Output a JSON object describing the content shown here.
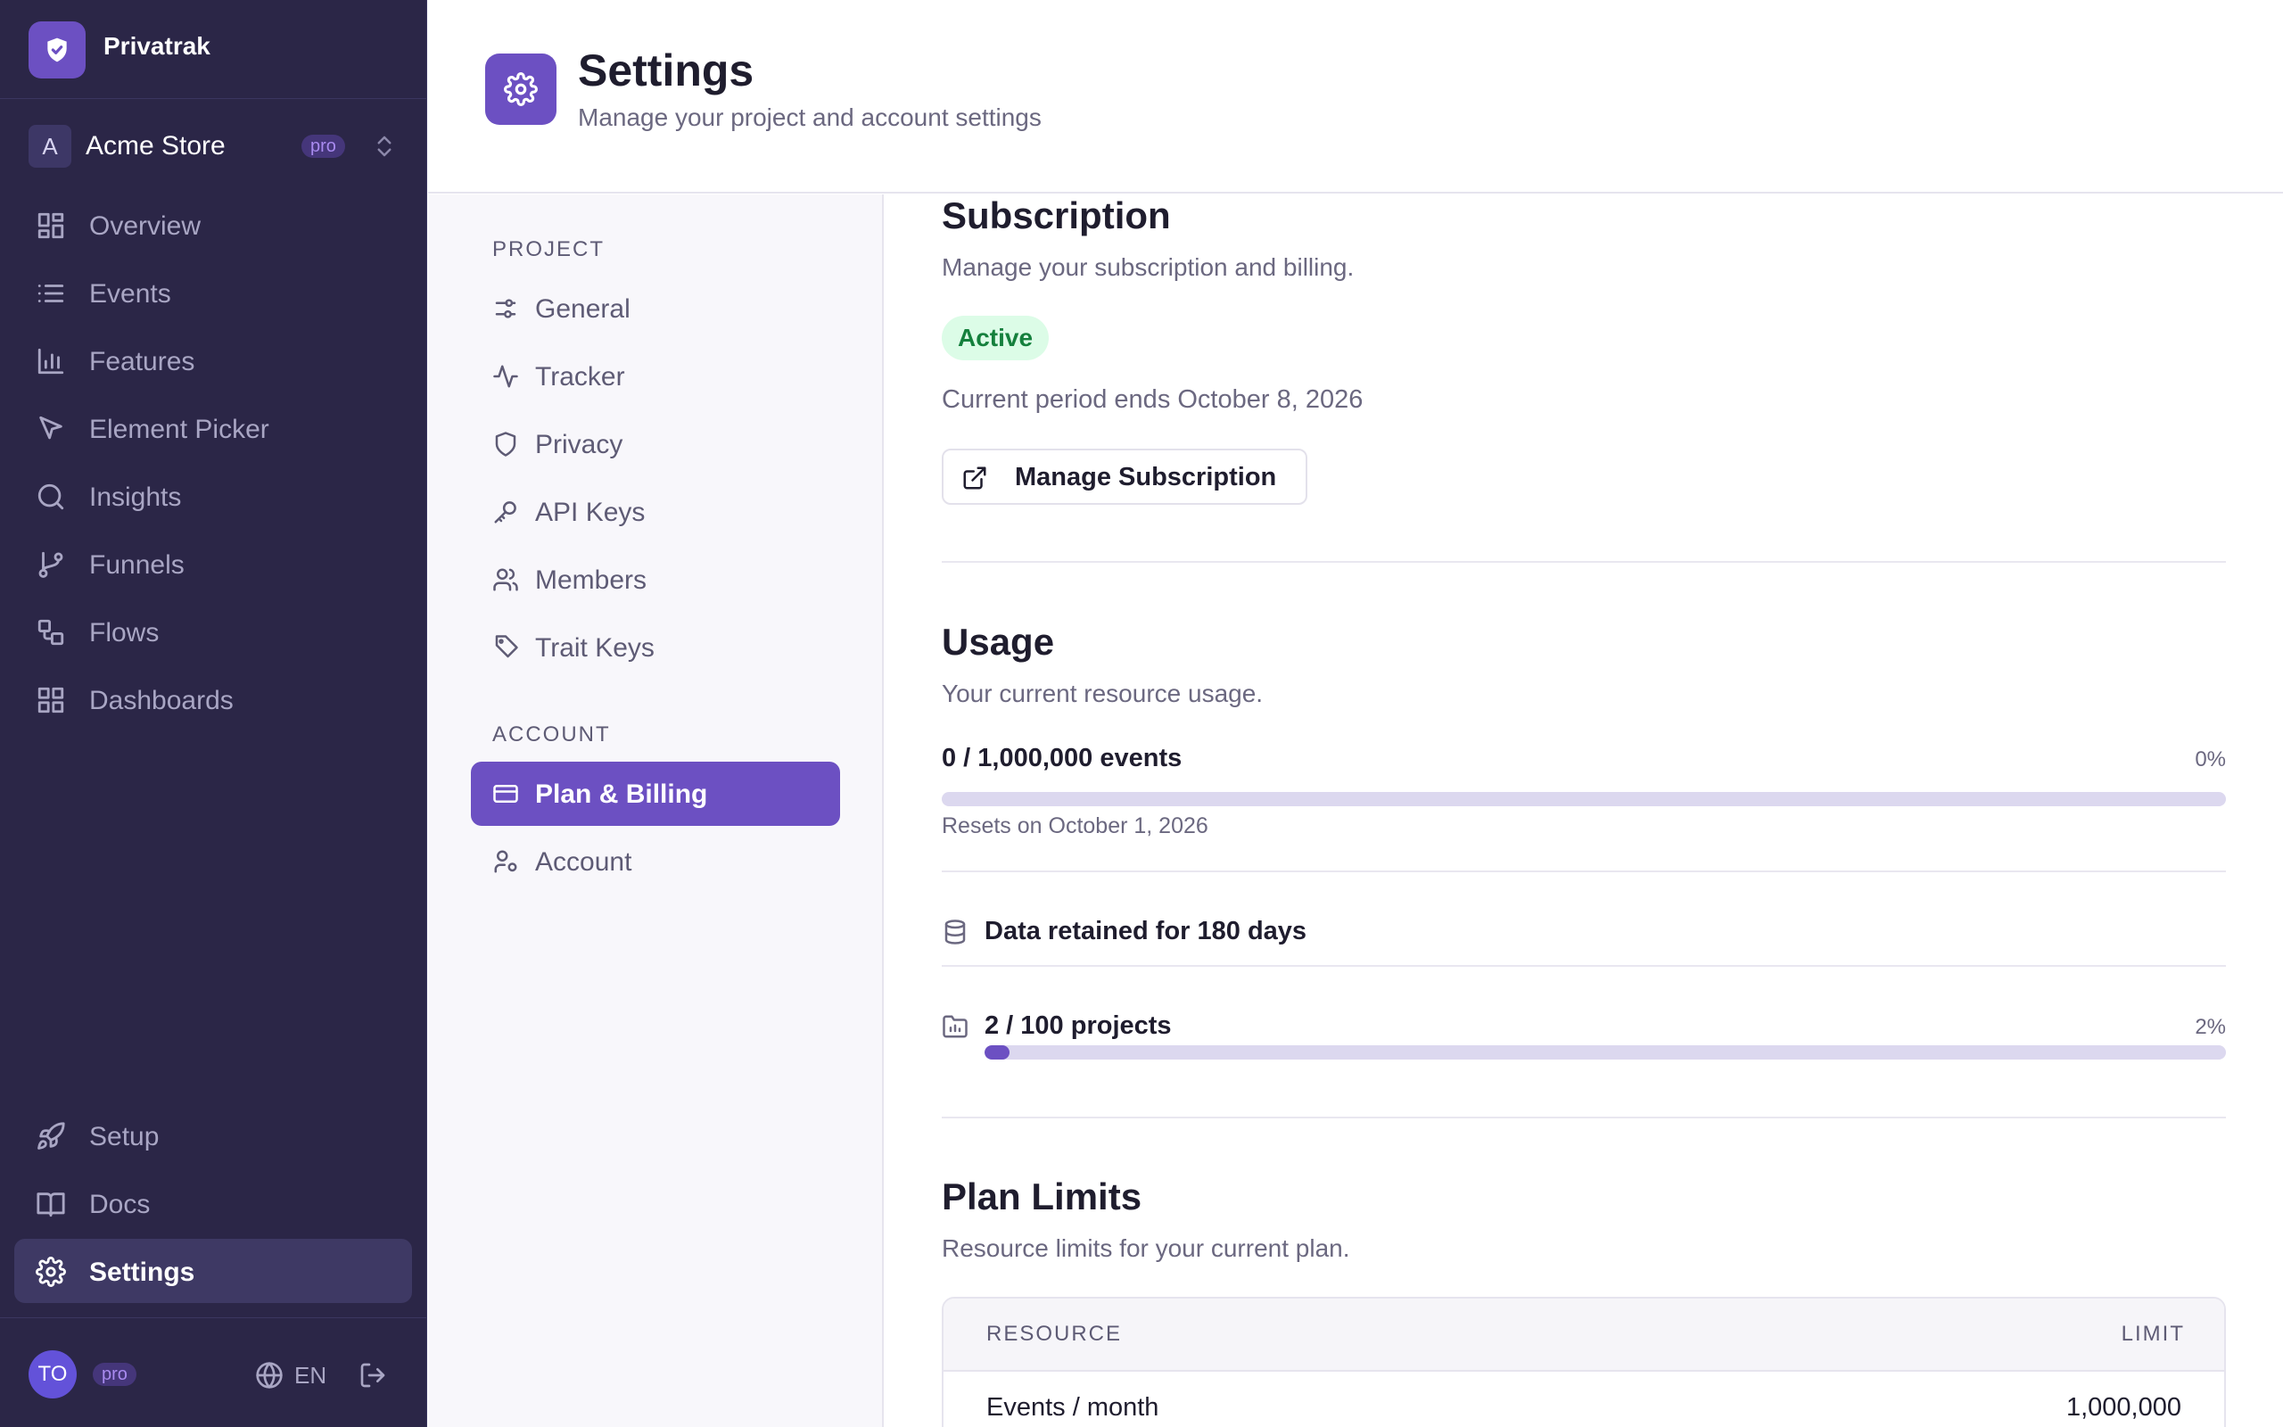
{
  "app": {
    "name": "Privatrak"
  },
  "project": {
    "initial": "A",
    "name": "Acme Store",
    "plan_badge": "pro"
  },
  "nav": {
    "main": [
      {
        "label": "Overview",
        "icon": "layout-grid-icon"
      },
      {
        "label": "Events",
        "icon": "list-icon"
      },
      {
        "label": "Features",
        "icon": "bar-chart-icon"
      },
      {
        "label": "Element Picker",
        "icon": "cursor-pointer-icon"
      },
      {
        "label": "Insights",
        "icon": "search-icon"
      },
      {
        "label": "Funnels",
        "icon": "git-branch-icon"
      },
      {
        "label": "Flows",
        "icon": "workflow-icon"
      },
      {
        "label": "Dashboards",
        "icon": "dashboard-grid-icon"
      }
    ],
    "bottom": [
      {
        "label": "Setup",
        "icon": "rocket-icon"
      },
      {
        "label": "Docs",
        "icon": "book-icon"
      },
      {
        "label": "Settings",
        "icon": "gear-icon",
        "active": true
      }
    ]
  },
  "footer": {
    "user_initials": "TO",
    "plan_badge": "pro",
    "language": "EN"
  },
  "header": {
    "title": "Settings",
    "subtitle": "Manage your project and account settings"
  },
  "settings_nav": {
    "project_heading": "PROJECT",
    "project_items": [
      {
        "label": "General",
        "icon": "sliders-icon"
      },
      {
        "label": "Tracker",
        "icon": "activity-icon"
      },
      {
        "label": "Privacy",
        "icon": "shield-icon"
      },
      {
        "label": "API Keys",
        "icon": "key-icon"
      },
      {
        "label": "Members",
        "icon": "users-icon"
      },
      {
        "label": "Trait Keys",
        "icon": "tag-icon"
      }
    ],
    "account_heading": "ACCOUNT",
    "account_items": [
      {
        "label": "Plan & Billing",
        "icon": "credit-card-icon",
        "active": true
      },
      {
        "label": "Account",
        "icon": "user-cog-icon"
      }
    ]
  },
  "subscription": {
    "title": "Subscription",
    "description": "Manage your subscription and billing.",
    "status": "Active",
    "period": "Current period ends October 8, 2026",
    "manage_button": "Manage Subscription"
  },
  "usage": {
    "title": "Usage",
    "description": "Your current resource usage.",
    "events": {
      "label": "0 / 1,000,000 events",
      "percent_label": "0%",
      "fraction": 0.0,
      "resets": "Resets on October 1, 2026"
    },
    "retention": {
      "label": "Data retained for 180 days"
    },
    "projects": {
      "label": "2 / 100 projects",
      "percent_label": "2%",
      "fraction": 0.02
    }
  },
  "plan_limits": {
    "title": "Plan Limits",
    "description": "Resource limits for your current plan.",
    "columns": [
      "RESOURCE",
      "LIMIT"
    ],
    "rows": [
      {
        "resource": "Events / month",
        "limit": "1,000,000"
      }
    ]
  },
  "colors": {
    "sidebar_bg": "#2b2647",
    "accent": "#6c50c2",
    "active_badge_bg": "#dcfce7",
    "active_badge_text": "#15803d",
    "progress_track": "#dcd8ef"
  }
}
